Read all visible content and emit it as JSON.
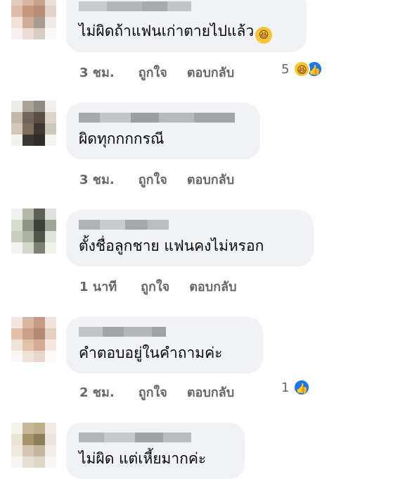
{
  "comments": [
    {
      "text": "ไม่ผิดถ้าแฟนเก่าตายไปแล้ว",
      "emoji_icon": "haha-emoji",
      "time": "3 ชม.",
      "like_label": "ถูกใจ",
      "reply_label": "ตอบกลับ",
      "reaction_count": "5",
      "reaction_icons": [
        "haha-icon",
        "like-icon"
      ]
    },
    {
      "text": "ผิดทุกกกกรณี",
      "time": "3 ชม.",
      "like_label": "ถูกใจ",
      "reply_label": "ตอบกลับ"
    },
    {
      "text": "ตั้งชื่อลูกชาย แฟนคงไม่หรอก",
      "time": "1 นาที",
      "like_label": "ถูกใจ",
      "reply_label": "ตอบกลับ"
    },
    {
      "text": "คำตอบอยู่ในคำถามค่ะ",
      "time": "2 ชม.",
      "like_label": "ถูกใจ",
      "reply_label": "ตอบกลับ",
      "reaction_count": "1",
      "reaction_icons": [
        "like-icon"
      ]
    },
    {
      "text": "ไม่ผิด แต่เหี้ยมากค่ะ"
    }
  ],
  "colors": {
    "bubble": "#f0f2f5",
    "meta_text": "#65676b",
    "like_blue": "#1877f2",
    "haha_yellow": "#f7c433"
  }
}
